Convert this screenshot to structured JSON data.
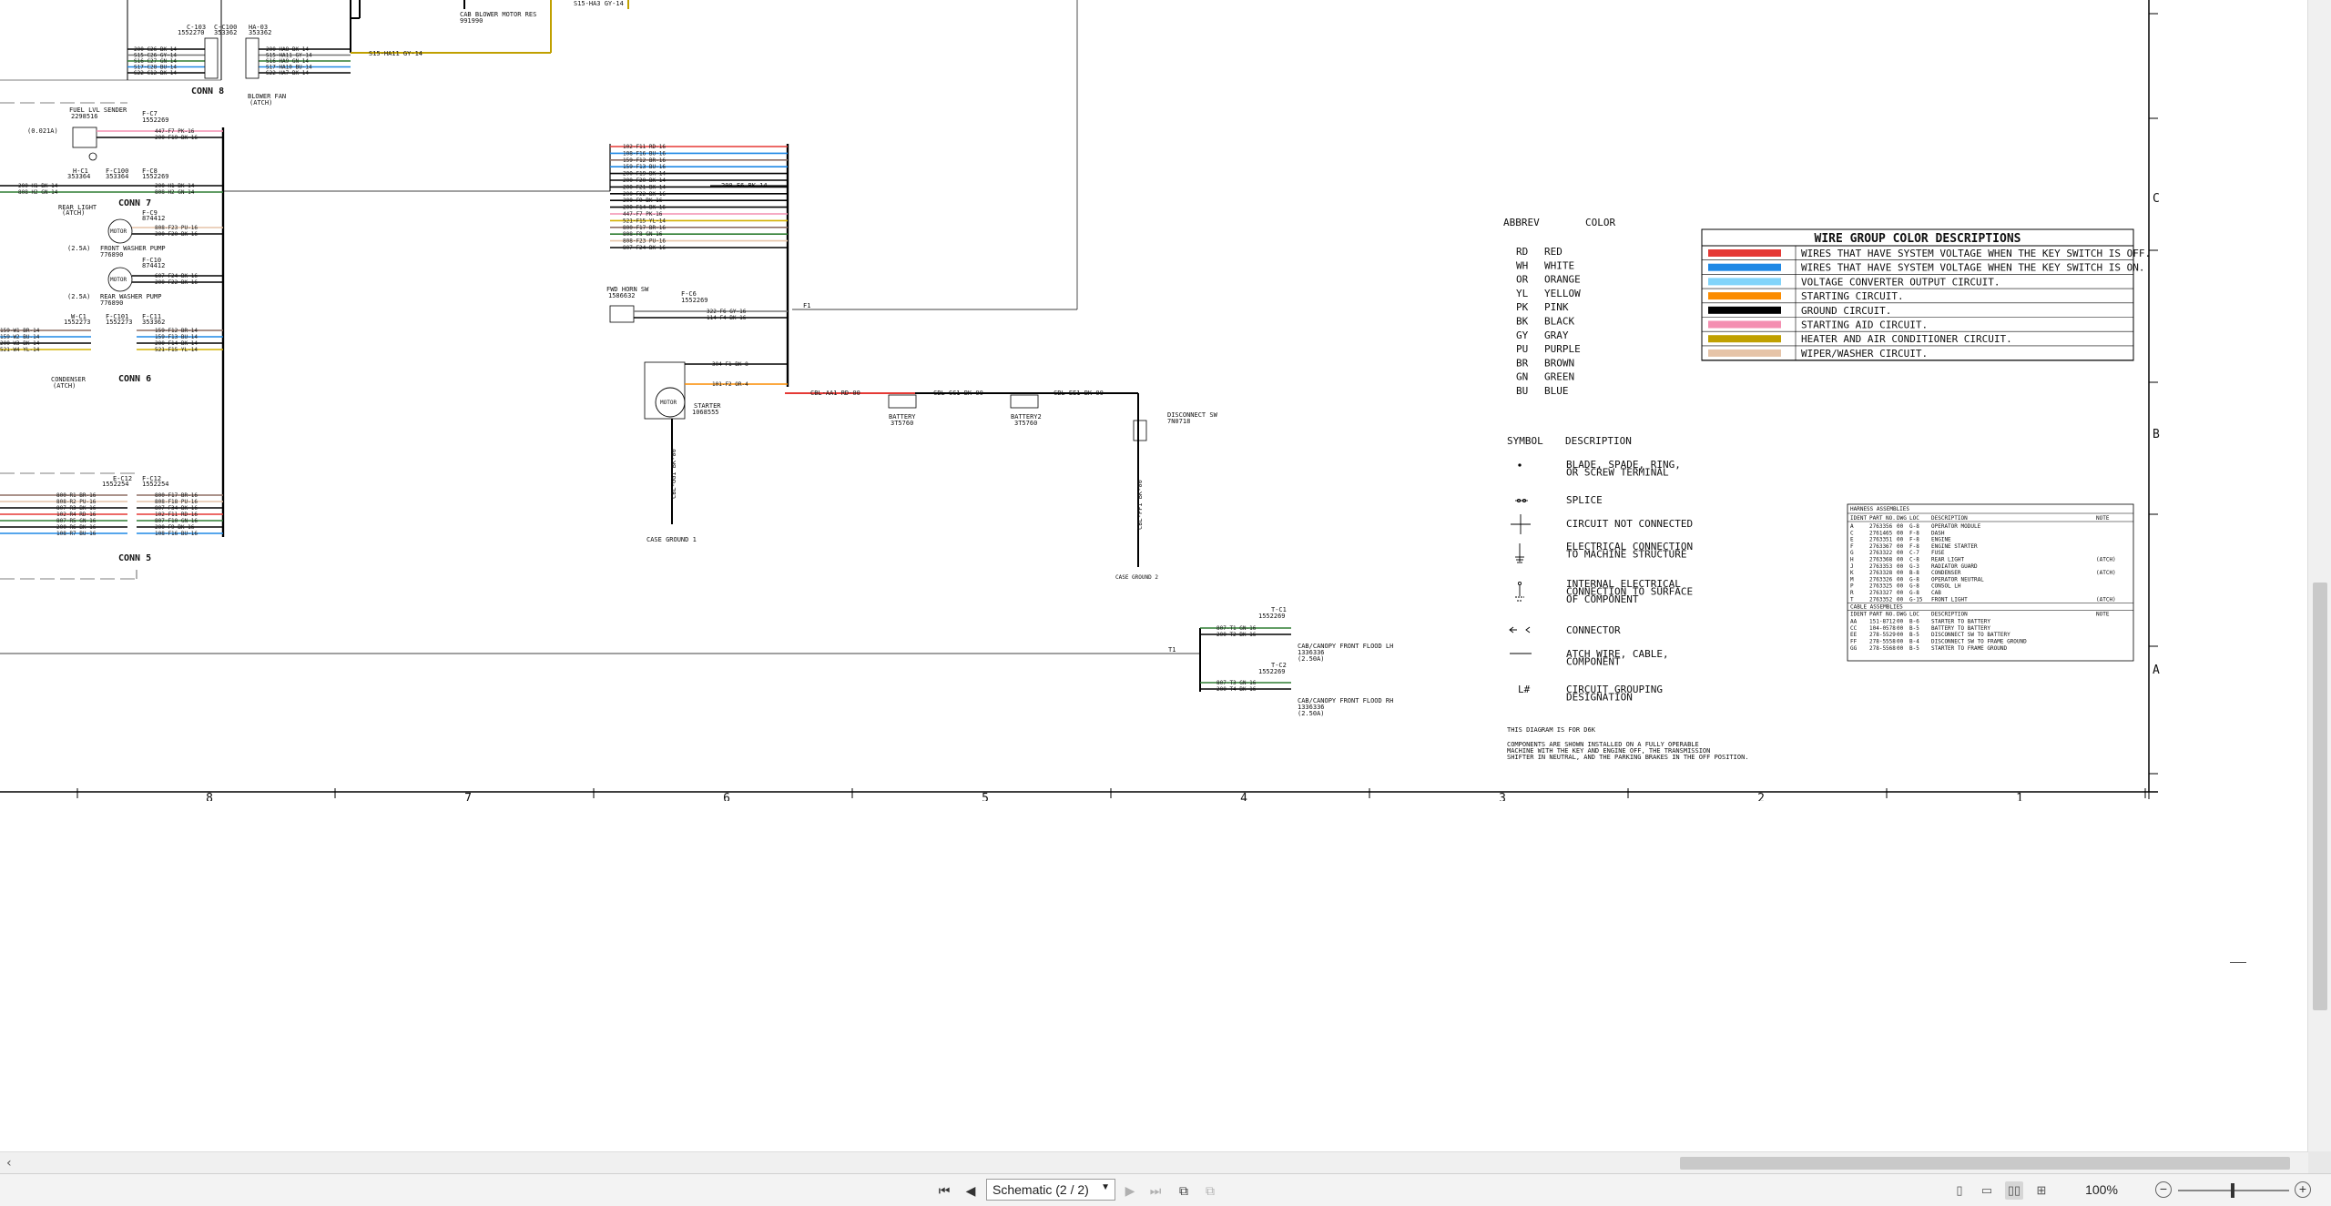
{
  "schematic": {
    "conn_labels": [
      "CONN 8",
      "CONN 7",
      "CONN 6",
      "CONN 5"
    ],
    "top_labels": {
      "c103": "C-103",
      "c103_num": "1552270",
      "cc100": "C-C100",
      "cc100_num": "353362",
      "ha03": "HA-03",
      "ha03_num": "353362",
      "blower_fan": "BLOWER FAN",
      "blower_fan_sub": "(ATCH)",
      "cab_blower": "CAB BLOWER MOTOR RES",
      "cab_blower_num": "991990",
      "s15_ha11": "S15-HA11 GY-14",
      "s15_ha": "S15-HA3 GY-14"
    },
    "left_labels": {
      "fuel_sender": "FUEL LVL SENDER",
      "fuel_sender_num": "2298516",
      "fuse_021": "(0.021A)",
      "rear_light": "REAR LIGHT",
      "rear_light_sub": "(ATCH)",
      "hc1": "H-C1",
      "hc1_num": "353364",
      "fc100": "F-C100",
      "fc100_num": "353364",
      "fc8": "F-C8",
      "fc8_num": "1552269",
      "fc7": "F-C7",
      "fc7_num": "1552269",
      "fc9": "F-C9",
      "fc9_num": "874412",
      "fc10": "F-C10",
      "fc10_num": "874412",
      "front_washer": "FRONT WASHER PUMP",
      "front_washer_num": "776890",
      "rear_washer": "REAR WASHER PUMP",
      "rear_washer_num": "776890",
      "fuse_25a_1": "(2.5A)",
      "fuse_25a_2": "(2.5A)",
      "motor1": "MOTOR",
      "motor2": "MOTOR",
      "wc1": "W-C1",
      "wc1_num": "1552273",
      "fc101": "F-C101",
      "fc101_num": "1552273",
      "fc11": "F-C11",
      "fc11_num": "353362",
      "condenser": "CONDENSER",
      "condenser_sub": "(ATCH)",
      "ec12": "E-C12",
      "ec12_num": "1552254",
      "fc12": "F-C12",
      "fc12_num": "1552254"
    },
    "wire_labels": {
      "conn8": [
        "200-C26 BK-14",
        "S15-C26 GY-14",
        "S16-C27 GN-14",
        "S17-C28 BU-14",
        "S22-C12 BK-14"
      ],
      "conn8_r": [
        "200-HA8 BK-14",
        "S15-HA11 GY-14",
        "S16-HA9 GN-14",
        "S17-HA10 BU-14",
        "S22-HA7 BK-14"
      ],
      "fuel": [
        "447-F7 PK-16",
        "200-F19 BK-16"
      ],
      "rear": [
        "200-H1 BK-14",
        "808-H2 GN-14"
      ],
      "conn7": [
        "200-F21 BK-14",
        "808-F8 GN-14"
      ],
      "washer1": [
        "808-F23 PU-16",
        "200-F20 BK-16"
      ],
      "washer2": [
        "607-F24 BK-16",
        "200-F22 BK-16"
      ],
      "conn6_l": [
        "159-W1 BR-14",
        "159-W2 BU-14",
        "200-W3 BK-14",
        "521-W4 YL-14"
      ],
      "conn6_r": [
        "159-F12 BR-14",
        "159-F13 BU-14",
        "200-F14 BK-14",
        "521-F15 YL-14"
      ],
      "conn5_l": [
        "800-R1 BR-16",
        "808-R2 PU-16",
        "807-R3 BK-16",
        "102-R4 RD-16",
        "807-R5 GN-16",
        "200-R6 BK-16",
        "108-R7 BU-16"
      ],
      "conn5_r": [
        "800-F17 BR-16",
        "808-F18 PU-16",
        "807-F34 BK-16",
        "102-F11 RD-16",
        "807-F10 GN-16",
        "200-F9 BK-16",
        "108-F16 BU-16"
      ],
      "bundle": [
        "102-F11 RD-16",
        "108-F16 BU-16",
        "159-F12 BR-16",
        "159-F13 BU-16",
        "200-F19 BK-14",
        "200-F20 BK-14",
        "200-F21 BK-14",
        "200-F22 BK-16",
        "200-F9 BK-16",
        "200-F14 BK-16",
        "447-F7 PK-16",
        "521-F15 YL-14",
        "800-F17 BR-16",
        "808-F8 GN-16",
        "808-F23 PU-16",
        "807-F24 BK-16"
      ],
      "bundle_out": "200-F6 BK-14",
      "horn": [
        "322-F6 GY-16",
        "114-F4 BK-16"
      ],
      "starter_in": [
        "304-F1 BK-8",
        "101-F2 OR-4"
      ],
      "cbl_aa1": "CBL-AA1 RD-00",
      "cbl_cc1": "CBL-CC1 BK-00",
      "cbl_ee1": "CBL-EE1 BK-00",
      "cbl_gg1": "CBL-GG1 BK-00",
      "cbl_ff1": "CBL-FF1 BK-00",
      "flood": [
        "807-T1 GN-16",
        "200-T2 BK-16",
        "807-T3 GN-16",
        "200-T4 BK-16"
      ]
    },
    "component_labels": {
      "fwd_horn": "FWD HORN SW",
      "fwd_horn_num": "1586632",
      "fc6": "F-C6",
      "fc6_num": "1552269",
      "starter": "STARTER",
      "starter_num": "1068555",
      "motor3": "MOTOR",
      "battery1": "BATTERY",
      "battery1_num": "3T5760",
      "battery2": "BATTERY2",
      "battery2_num": "3T5760",
      "disconnect": "DISCONNECT SW",
      "disconnect_num": "7N0718",
      "case_ground1": "CASE GROUND 1",
      "case_ground2": "CASE GROUND 2",
      "tc1": "T-C1",
      "tc1_num": "1552269",
      "tc2": "T-C2",
      "tc2_num": "1552269",
      "flood_lh": "CAB/CANOPY FRONT FLOOD LH",
      "flood_lh_num": "1336336",
      "flood_lh_fuse": "(2.50A)",
      "flood_rh": "CAB/CANOPY FRONT FLOOD RH",
      "flood_rh_num": "1336336",
      "flood_rh_fuse": "(2.50A)",
      "t1": "T1",
      "f1": "F1"
    },
    "abbrev": {
      "header_abbrev": "ABBREV",
      "header_color": "COLOR",
      "rows": [
        {
          "abbrev": "RD",
          "color": "RED"
        },
        {
          "abbrev": "WH",
          "color": "WHITE"
        },
        {
          "abbrev": "OR",
          "color": "ORANGE"
        },
        {
          "abbrev": "YL",
          "color": "YELLOW"
        },
        {
          "abbrev": "PK",
          "color": "PINK"
        },
        {
          "abbrev": "BK",
          "color": "BLACK"
        },
        {
          "abbrev": "GY",
          "color": "GRAY"
        },
        {
          "abbrev": "PU",
          "color": "PURPLE"
        },
        {
          "abbrev": "BR",
          "color": "BROWN"
        },
        {
          "abbrev": "GN",
          "color": "GREEN"
        },
        {
          "abbrev": "BU",
          "color": "BLUE"
        }
      ]
    },
    "symbols": {
      "header_symbol": "SYMBOL",
      "header_desc": "DESCRIPTION",
      "rows": [
        [
          "BLADE, SPADE, RING,",
          "OR SCREW TERMINAL"
        ],
        [
          "SPLICE"
        ],
        [
          "CIRCUIT NOT CONNECTED"
        ],
        [
          "ELECTRICAL CONNECTION",
          "TO MACHINE STRUCTURE"
        ],
        [
          "INTERNAL ELECTRICAL",
          "CONNECTION TO SURFACE",
          "OF COMPONENT"
        ],
        [
          "CONNECTOR"
        ],
        [
          "ATCH WIRE, CABLE,",
          "COMPONENT"
        ],
        [
          "CIRCUIT GROUPING",
          "DESIGNATION"
        ]
      ],
      "grouping_symbol": "L#"
    },
    "notes": {
      "note1": "THIS DIAGRAM IS FOR D6K",
      "note2": "COMPONENTS ARE SHOWN INSTALLED ON A FULLY OPERABLE",
      "note3": "MACHINE WITH THE KEY AND ENGINE OFF, THE TRANSMISSION",
      "note4": "SHIFTER IN NEUTRAL, AND THE PARKING BRAKES IN THE OFF POSITION."
    },
    "wire_groups": {
      "title": "WIRE GROUP COLOR DESCRIPTIONS",
      "rows": [
        {
          "color": "#e53935",
          "text": "WIRES THAT HAVE SYSTEM VOLTAGE WHEN THE KEY SWITCH IS OFF."
        },
        {
          "color": "#1e88e5",
          "text": "WIRES THAT HAVE SYSTEM VOLTAGE WHEN THE KEY SWITCH IS ON."
        },
        {
          "color": "#81d4fa",
          "text": "VOLTAGE CONVERTER OUTPUT CIRCUIT."
        },
        {
          "color": "#fb8c00",
          "text": "STARTING CIRCUIT."
        },
        {
          "color": "#000000",
          "text": "GROUND CIRCUIT."
        },
        {
          "color": "#f48fb1",
          "text": "STARTING AID CIRCUIT."
        },
        {
          "color": "#c0a000",
          "text": "HEATER AND AIR CONDITIONER CIRCUIT."
        },
        {
          "color": "#e6c4a8",
          "text": "WIPER/WASHER CIRCUIT."
        }
      ]
    },
    "harness": {
      "title": "HARNESS ASSEMBLIES",
      "headers": [
        "IDENT",
        "PART NO.",
        "DWG",
        "LOC",
        "DESCRIPTION",
        "NOTE"
      ],
      "rows": [
        [
          "A",
          "2763356",
          "00",
          "G-8",
          "OPERATOR MODULE",
          ""
        ],
        [
          "C",
          "2761465",
          "00",
          "F-8",
          "DASH",
          ""
        ],
        [
          "E",
          "2763351",
          "00",
          "F-8",
          "ENGINE",
          ""
        ],
        [
          "F",
          "2763367",
          "00",
          "F-8",
          "ENGINE STARTER",
          ""
        ],
        [
          "G",
          "2763322",
          "00",
          "C-7",
          "FUSE",
          ""
        ],
        [
          "H",
          "2763368",
          "00",
          "C-8",
          "REAR LIGHT",
          "(ATCH)"
        ],
        [
          "J",
          "2763353",
          "00",
          "G-3",
          "RADIATOR GUARD",
          ""
        ],
        [
          "K",
          "2763328",
          "00",
          "B-8",
          "CONDENSER",
          "(ATCH)"
        ],
        [
          "M",
          "2763326",
          "00",
          "G-8",
          "OPERATOR NEUTRAL",
          ""
        ],
        [
          "P",
          "2763325",
          "00",
          "G-8",
          "CONSOL LH",
          ""
        ],
        [
          "R",
          "2763327",
          "00",
          "G-8",
          "CAB",
          ""
        ],
        [
          "T",
          "2763352",
          "00",
          "G-15",
          "FRONT LIGHT",
          "(ATCH)"
        ]
      ],
      "cable_title": "CABLE ASSEMBLIES",
      "cable_rows": [
        [
          "AA",
          "151-8712",
          "00",
          "B-6",
          "STARTER TO BATTERY",
          ""
        ],
        [
          "CC",
          "104-0578",
          "00",
          "B-5",
          "BATTERY TO BATTERY",
          ""
        ],
        [
          "EE",
          "278-5529",
          "00",
          "B-5",
          "DISCONNECT SW TO BATTERY",
          ""
        ],
        [
          "FF",
          "278-5558",
          "00",
          "B-4",
          "DISCONNECT SW TO FRAME GROUND",
          ""
        ],
        [
          "GG",
          "278-5568",
          "00",
          "B-5",
          "STARTER TO FRAME GROUND",
          ""
        ]
      ]
    },
    "zones_h": [
      "8",
      "7",
      "6",
      "5",
      "4",
      "3",
      "2",
      "1"
    ],
    "zones_v": [
      "C",
      "B",
      "A"
    ]
  },
  "statusbar": {
    "page_select": "Schematic (2 / 2)",
    "zoom": "100%",
    "zoom_out": "−",
    "zoom_in": "+"
  },
  "icons": {
    "first": "first-page-icon",
    "prev": "previous-page-icon",
    "next": "next-page-icon",
    "last": "last-page-icon"
  }
}
